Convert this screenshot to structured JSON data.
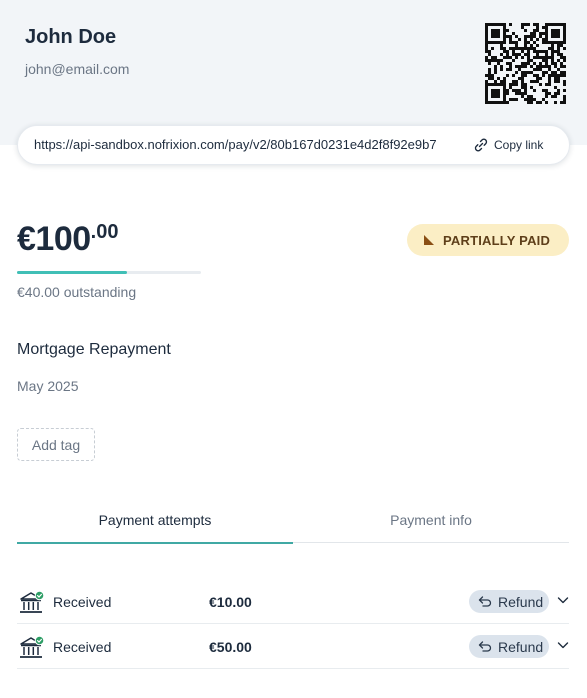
{
  "payer": {
    "name": "John Doe",
    "email": "john@email.com"
  },
  "link": {
    "url": "https://api-sandbox.nofrixion.com/pay/v2/80b167d0231e4d2f8f92e9b7",
    "copy_label": "Copy link",
    "icon": "link-icon"
  },
  "payment": {
    "currency_symbol": "€",
    "amount_whole": "100",
    "amount_decimal": ".00",
    "status_label": "PARTIALLY PAID",
    "status_color": "#fbeec5",
    "paid_fraction": 0.6,
    "outstanding_text": "€40.00 outstanding",
    "description": "Mortgage Repayment",
    "period": "May 2025",
    "add_tag_label": "Add tag"
  },
  "tabs": [
    {
      "label": "Payment attempts",
      "active": true
    },
    {
      "label": "Payment info",
      "active": false
    }
  ],
  "attempts": [
    {
      "status": "Received",
      "amount": "€10.00",
      "refund_label": "Refund",
      "icon": "bank-icon"
    },
    {
      "status": "Received",
      "amount": "€50.00",
      "refund_label": "Refund",
      "icon": "bank-icon"
    }
  ],
  "colors": {
    "accent": "#40a9a4",
    "success": "#2e9e66",
    "badge_text": "#5e3f1a",
    "header_bg": "#f2f5f8"
  }
}
